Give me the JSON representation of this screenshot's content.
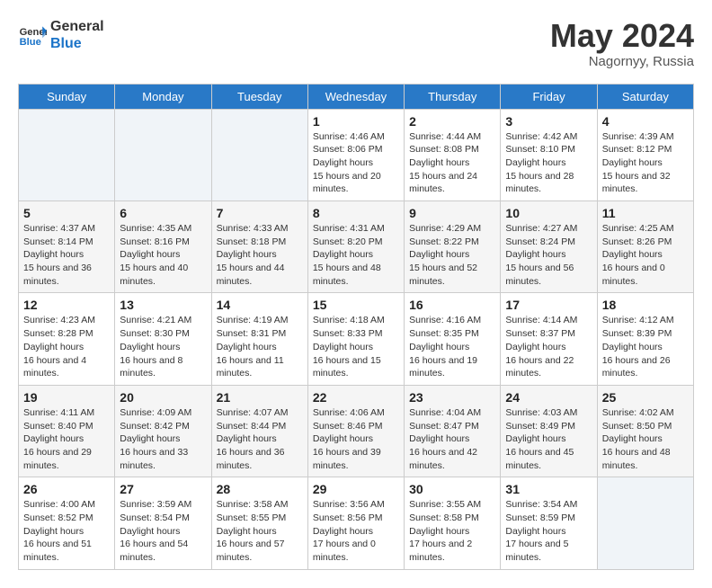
{
  "header": {
    "logo_line1": "General",
    "logo_line2": "Blue",
    "month": "May 2024",
    "location": "Nagornyy, Russia"
  },
  "weekdays": [
    "Sunday",
    "Monday",
    "Tuesday",
    "Wednesday",
    "Thursday",
    "Friday",
    "Saturday"
  ],
  "weeks": [
    [
      {
        "day": "",
        "empty": true
      },
      {
        "day": "",
        "empty": true
      },
      {
        "day": "",
        "empty": true
      },
      {
        "day": "1",
        "sunrise": "4:46 AM",
        "sunset": "8:06 PM",
        "daylight": "15 hours and 20 minutes."
      },
      {
        "day": "2",
        "sunrise": "4:44 AM",
        "sunset": "8:08 PM",
        "daylight": "15 hours and 24 minutes."
      },
      {
        "day": "3",
        "sunrise": "4:42 AM",
        "sunset": "8:10 PM",
        "daylight": "15 hours and 28 minutes."
      },
      {
        "day": "4",
        "sunrise": "4:39 AM",
        "sunset": "8:12 PM",
        "daylight": "15 hours and 32 minutes."
      }
    ],
    [
      {
        "day": "5",
        "sunrise": "4:37 AM",
        "sunset": "8:14 PM",
        "daylight": "15 hours and 36 minutes."
      },
      {
        "day": "6",
        "sunrise": "4:35 AM",
        "sunset": "8:16 PM",
        "daylight": "15 hours and 40 minutes."
      },
      {
        "day": "7",
        "sunrise": "4:33 AM",
        "sunset": "8:18 PM",
        "daylight": "15 hours and 44 minutes."
      },
      {
        "day": "8",
        "sunrise": "4:31 AM",
        "sunset": "8:20 PM",
        "daylight": "15 hours and 48 minutes."
      },
      {
        "day": "9",
        "sunrise": "4:29 AM",
        "sunset": "8:22 PM",
        "daylight": "15 hours and 52 minutes."
      },
      {
        "day": "10",
        "sunrise": "4:27 AM",
        "sunset": "8:24 PM",
        "daylight": "15 hours and 56 minutes."
      },
      {
        "day": "11",
        "sunrise": "4:25 AM",
        "sunset": "8:26 PM",
        "daylight": "16 hours and 0 minutes."
      }
    ],
    [
      {
        "day": "12",
        "sunrise": "4:23 AM",
        "sunset": "8:28 PM",
        "daylight": "16 hours and 4 minutes."
      },
      {
        "day": "13",
        "sunrise": "4:21 AM",
        "sunset": "8:30 PM",
        "daylight": "16 hours and 8 minutes."
      },
      {
        "day": "14",
        "sunrise": "4:19 AM",
        "sunset": "8:31 PM",
        "daylight": "16 hours and 11 minutes."
      },
      {
        "day": "15",
        "sunrise": "4:18 AM",
        "sunset": "8:33 PM",
        "daylight": "16 hours and 15 minutes."
      },
      {
        "day": "16",
        "sunrise": "4:16 AM",
        "sunset": "8:35 PM",
        "daylight": "16 hours and 19 minutes."
      },
      {
        "day": "17",
        "sunrise": "4:14 AM",
        "sunset": "8:37 PM",
        "daylight": "16 hours and 22 minutes."
      },
      {
        "day": "18",
        "sunrise": "4:12 AM",
        "sunset": "8:39 PM",
        "daylight": "16 hours and 26 minutes."
      }
    ],
    [
      {
        "day": "19",
        "sunrise": "4:11 AM",
        "sunset": "8:40 PM",
        "daylight": "16 hours and 29 minutes."
      },
      {
        "day": "20",
        "sunrise": "4:09 AM",
        "sunset": "8:42 PM",
        "daylight": "16 hours and 33 minutes."
      },
      {
        "day": "21",
        "sunrise": "4:07 AM",
        "sunset": "8:44 PM",
        "daylight": "16 hours and 36 minutes."
      },
      {
        "day": "22",
        "sunrise": "4:06 AM",
        "sunset": "8:46 PM",
        "daylight": "16 hours and 39 minutes."
      },
      {
        "day": "23",
        "sunrise": "4:04 AM",
        "sunset": "8:47 PM",
        "daylight": "16 hours and 42 minutes."
      },
      {
        "day": "24",
        "sunrise": "4:03 AM",
        "sunset": "8:49 PM",
        "daylight": "16 hours and 45 minutes."
      },
      {
        "day": "25",
        "sunrise": "4:02 AM",
        "sunset": "8:50 PM",
        "daylight": "16 hours and 48 minutes."
      }
    ],
    [
      {
        "day": "26",
        "sunrise": "4:00 AM",
        "sunset": "8:52 PM",
        "daylight": "16 hours and 51 minutes."
      },
      {
        "day": "27",
        "sunrise": "3:59 AM",
        "sunset": "8:54 PM",
        "daylight": "16 hours and 54 minutes."
      },
      {
        "day": "28",
        "sunrise": "3:58 AM",
        "sunset": "8:55 PM",
        "daylight": "16 hours and 57 minutes."
      },
      {
        "day": "29",
        "sunrise": "3:56 AM",
        "sunset": "8:56 PM",
        "daylight": "17 hours and 0 minutes."
      },
      {
        "day": "30",
        "sunrise": "3:55 AM",
        "sunset": "8:58 PM",
        "daylight": "17 hours and 2 minutes."
      },
      {
        "day": "31",
        "sunrise": "3:54 AM",
        "sunset": "8:59 PM",
        "daylight": "17 hours and 5 minutes."
      },
      {
        "day": "",
        "empty": true
      }
    ]
  ],
  "labels": {
    "sunrise": "Sunrise:",
    "sunset": "Sunset:",
    "daylight": "Daylight hours"
  }
}
